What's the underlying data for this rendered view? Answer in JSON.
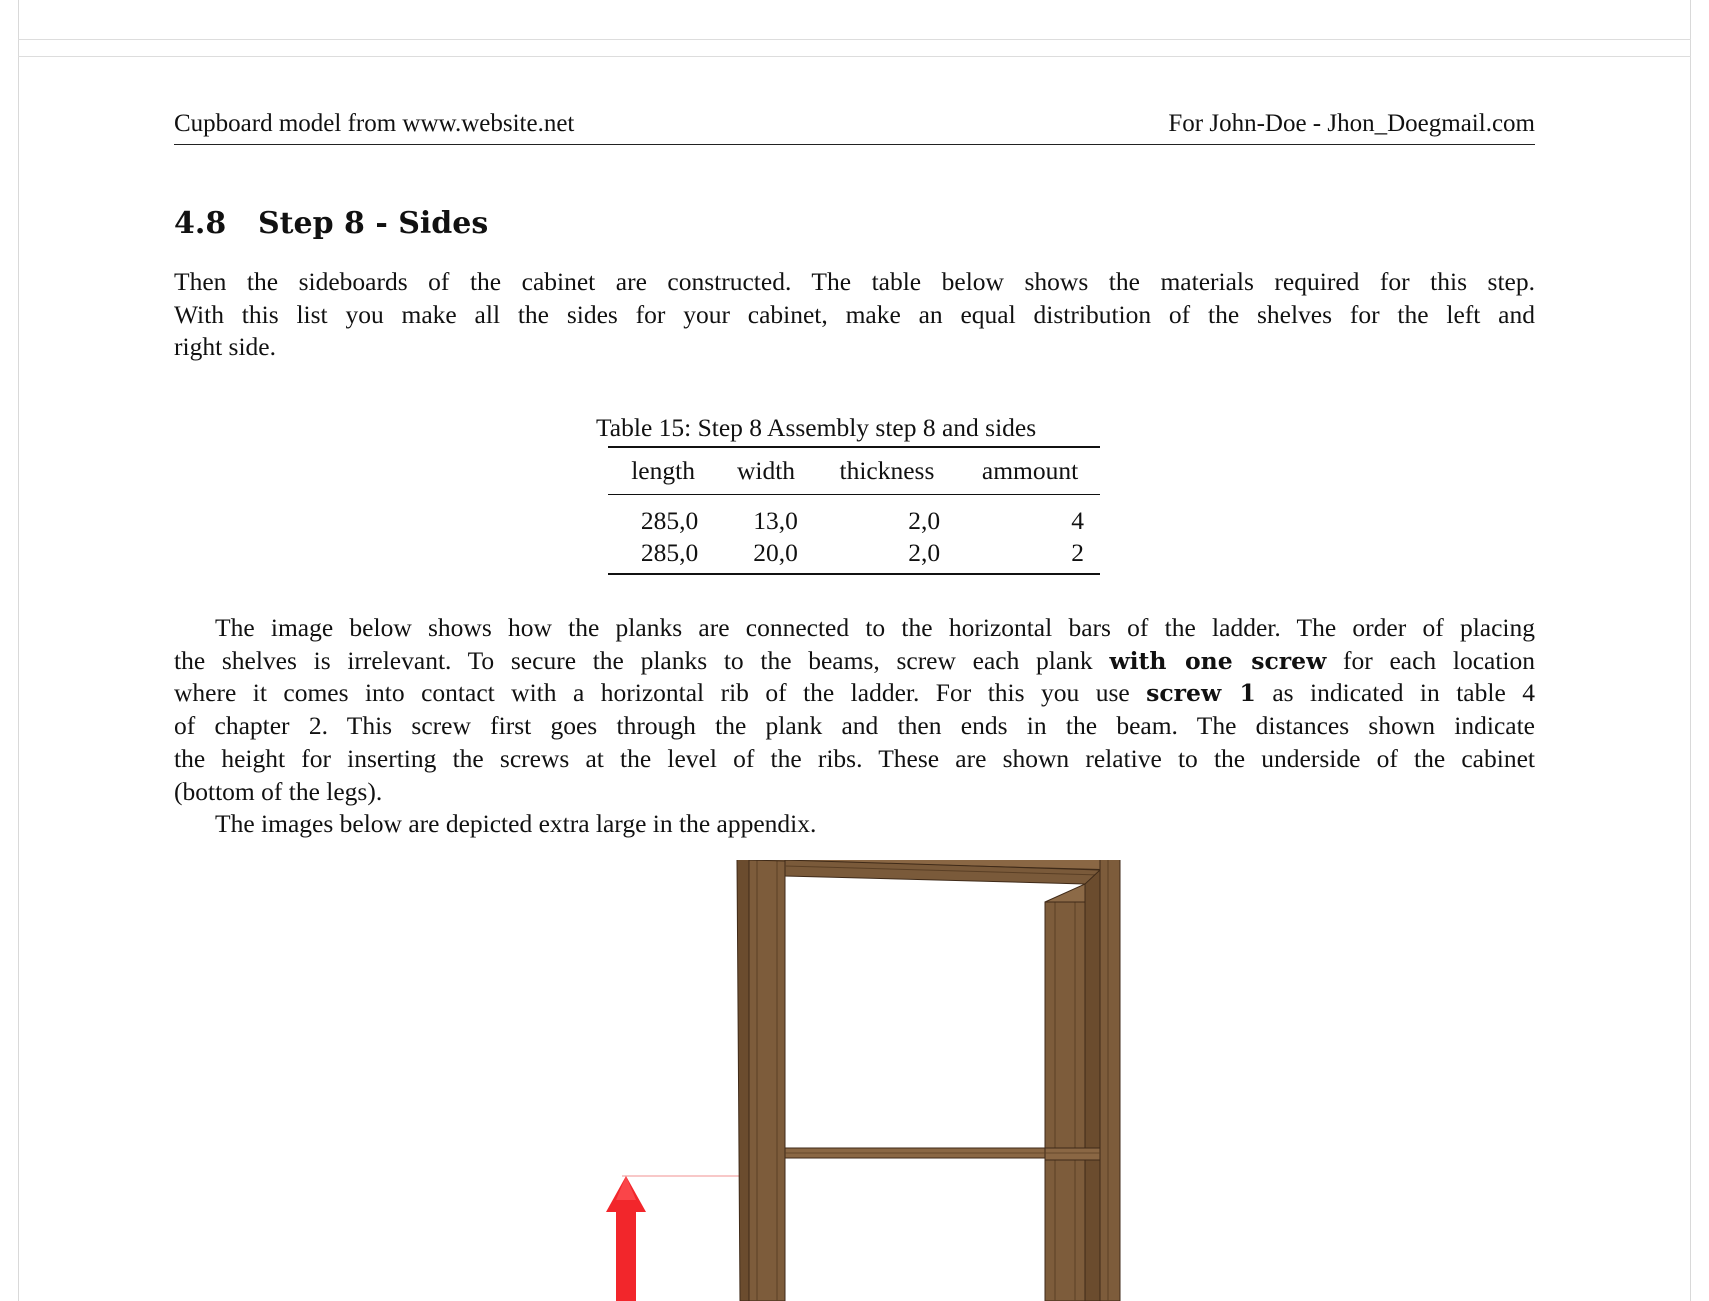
{
  "header": {
    "left": "Cupboard model from www.website.net",
    "right": "For John-Doe - Jhon_Doegmail.com"
  },
  "section": {
    "number": "4.8",
    "title": "Step 8 - Sides"
  },
  "intro_lines": [
    "Then the sideboards of the cabinet are constructed.  The table below shows the materials required for this step.",
    "With this list you make all the sides for your cabinet, make an equal distribution of the shelves for the left and",
    "right side."
  ],
  "table": {
    "caption": "Table 15:  Step 8 Assembly step 8 and sides",
    "headers": [
      "length",
      "width",
      "thickness",
      "ammount"
    ],
    "rows": [
      [
        "285,0",
        "13,0",
        "2,0",
        "4"
      ],
      [
        "285,0",
        "20,0",
        "2,0",
        "2"
      ]
    ]
  },
  "body_paragraph": {
    "line1": "The image below shows how the planks are connected to the horizontal bars of the ladder. The order of placing",
    "line2_pre": "the shelves is irrelevant.  To secure the planks to the beams, screw each plank ",
    "line2_bold": "with one screw",
    "line2_post": " for each location",
    "line3_pre": "where it comes into contact with a horizontal rib of the ladder.  For this you use ",
    "line3_bold": "screw 1",
    "line3_post": " as indicated in table 4",
    "line4": "of chapter 2.  This screw first goes through the plank and then ends in the beam.  The distances shown indicate",
    "line5": "the height for inserting the screws at the level of the ribs. These are shown relative to the underside of the cabinet",
    "line6": "(bottom of the legs)."
  },
  "appendix_note": "The images below are depicted extra large in the appendix.",
  "colors": {
    "wood_dark": "#5e4329",
    "wood_mid": "#7a5a3a",
    "wood_light": "#8c6a47",
    "arrow_red": "#f2262b"
  }
}
